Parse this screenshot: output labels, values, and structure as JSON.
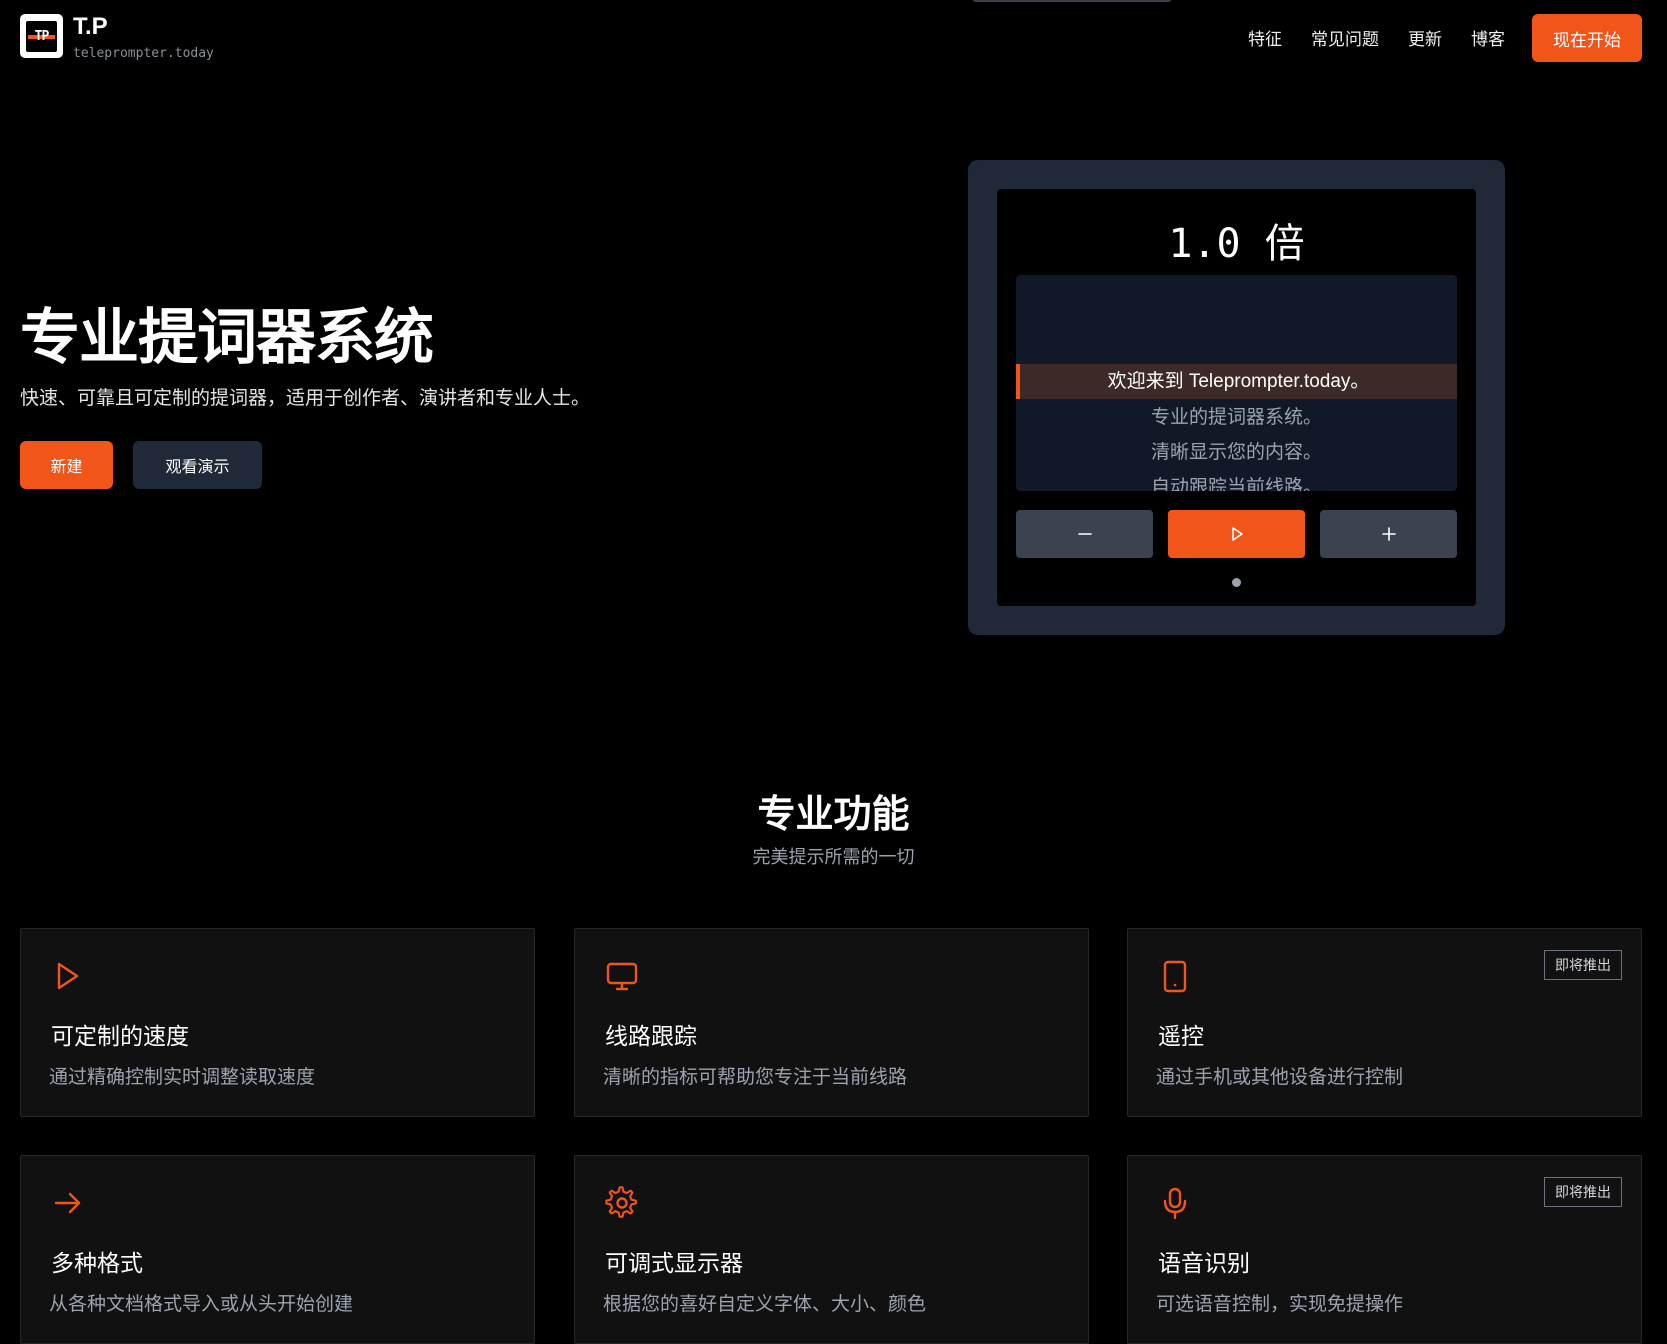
{
  "brand": {
    "logo_text": "TP",
    "title": "T.P",
    "subtitle": "teleprompter.today"
  },
  "nav": {
    "links": [
      "特征",
      "常见问题",
      "更新",
      "博客"
    ],
    "cta_label": "现在开始"
  },
  "hero": {
    "title": "专业提词器系统",
    "subtitle": "快速、可靠且可定制的提词器，适用于创作者、演讲者和专业人士。",
    "primary_button": "新建",
    "secondary_button": "观看演示"
  },
  "prompter": {
    "speed_display": "1.0 倍",
    "lines": [
      "欢迎来到 Teleprompter.today。",
      "专业的提词器系统。",
      "清晰显示您的内容。",
      "自动跟踪当前线路。"
    ],
    "active_line_index": 0,
    "controls": {
      "decrease_icon": "minus-icon",
      "play_icon": "play-icon",
      "increase_icon": "plus-icon"
    }
  },
  "features": {
    "title": "专业功能",
    "subtitle": "完美提示所需的一切",
    "accent_color": "#f2551a",
    "items": [
      {
        "icon": "play-icon",
        "title": "可定制的速度",
        "desc": "通过精确控制实时调整读取速度",
        "badge": ""
      },
      {
        "icon": "monitor-icon",
        "title": "线路跟踪",
        "desc": "清晰的指标可帮助您专注于当前线路",
        "badge": ""
      },
      {
        "icon": "tablet-icon",
        "title": "遥控",
        "desc": "通过手机或其他设备进行控制",
        "badge": "即将推出"
      },
      {
        "icon": "arrow-right-icon",
        "title": "多种格式",
        "desc": "从各种文档格式导入或从头开始创建",
        "badge": ""
      },
      {
        "icon": "gear-icon",
        "title": "可调式显示器",
        "desc": "根据您的喜好自定义字体、大小、颜色",
        "badge": ""
      },
      {
        "icon": "microphone-icon",
        "title": "语音识别",
        "desc": "可选语音控制，实现免提操作",
        "badge": "即将推出"
      }
    ]
  }
}
